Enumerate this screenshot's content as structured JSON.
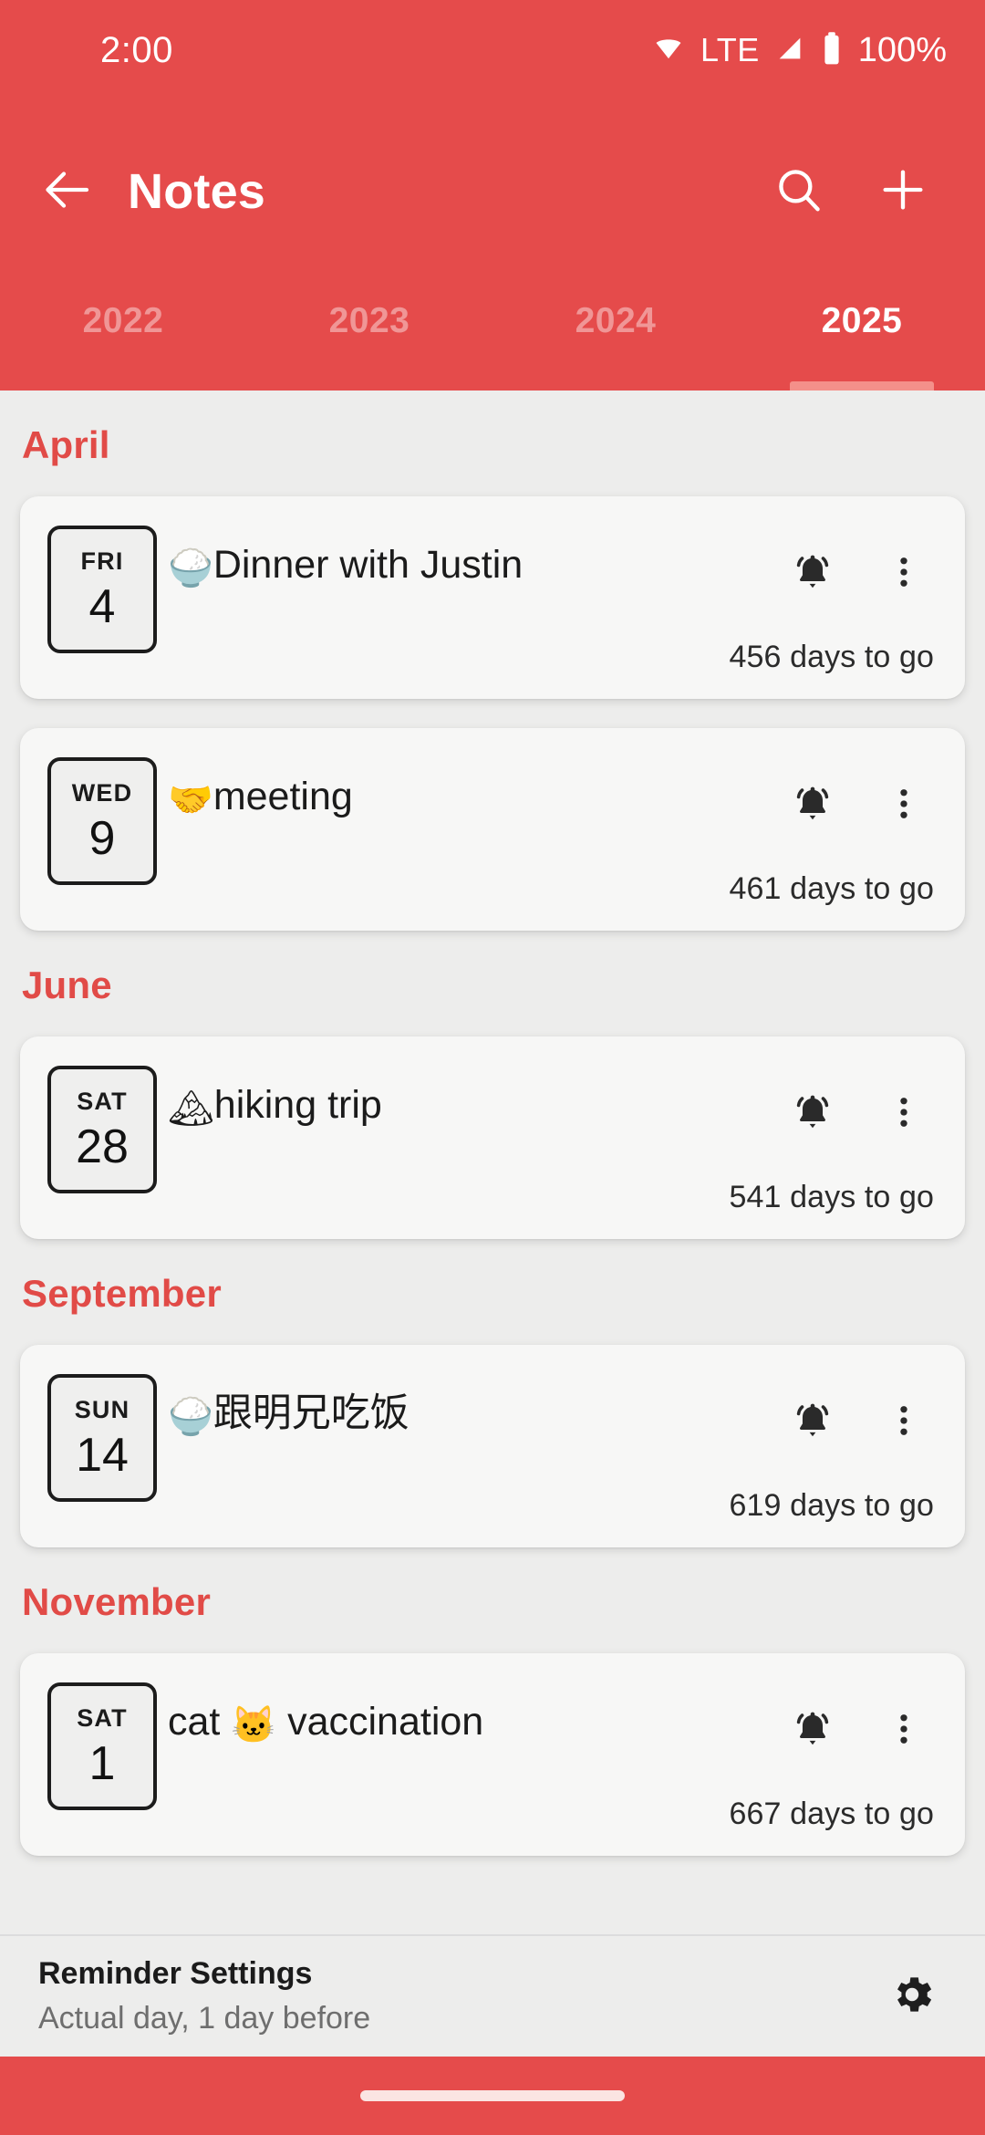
{
  "status_bar": {
    "time": "2:00",
    "network_label": "LTE",
    "battery_percent": "100%",
    "icons": {
      "wifi": "wifi-icon",
      "signal": "cellular-signal-icon",
      "battery": "battery-icon"
    }
  },
  "app_bar": {
    "title": "Notes",
    "back": "back-arrow-icon",
    "search": "search-icon",
    "add": "plus-icon"
  },
  "tabs": {
    "items": [
      {
        "label": "2022",
        "active": false
      },
      {
        "label": "2023",
        "active": false
      },
      {
        "label": "2024",
        "active": false
      },
      {
        "label": "2025",
        "active": true
      }
    ],
    "active_index": 3,
    "indicator_color": "#F4908A"
  },
  "colors": {
    "accent_red": "#E54B4B",
    "month_header": "#E14B47",
    "page_background": "#EDEDEC",
    "card_background": "#F7F7F6"
  },
  "sections": [
    {
      "month": "April",
      "events": [
        {
          "dow": "FRI",
          "day": "4",
          "emoji": "🍚",
          "title": "Dinner with Justin",
          "days_to_go": "456 days to go",
          "bell": "alarm-bell-icon",
          "more": "more-vertical-icon"
        },
        {
          "dow": "WED",
          "day": "9",
          "emoji": "🤝",
          "title": "meeting",
          "days_to_go": "461 days to go",
          "bell": "alarm-bell-icon",
          "more": "more-vertical-icon"
        }
      ]
    },
    {
      "month": "June",
      "events": [
        {
          "dow": "SAT",
          "day": "28",
          "emoji": "🏔",
          "title": "hiking trip",
          "days_to_go": "541 days to go",
          "bell": "alarm-bell-icon",
          "more": "more-vertical-icon"
        }
      ]
    },
    {
      "month": "September",
      "events": [
        {
          "dow": "SUN",
          "day": "14",
          "emoji": "🍚",
          "title": "跟明兄吃饭",
          "days_to_go": "619 days to go",
          "bell": "alarm-bell-icon",
          "more": "more-vertical-icon"
        }
      ]
    },
    {
      "month": "November",
      "events": [
        {
          "dow": "SAT",
          "day": "1",
          "emoji": "🐱",
          "title_prefix": "cat ",
          "title_suffix": " vaccination",
          "title": "cat 🐱 vaccination",
          "days_to_go": "667 days to go",
          "bell": "alarm-bell-icon",
          "more": "more-vertical-icon"
        }
      ]
    }
  ],
  "reminder": {
    "title": "Reminder Settings",
    "subtitle": "Actual day, 1 day before",
    "gear": "gear-icon"
  },
  "nav_bar": {
    "home_indicator": "home-indicator"
  }
}
